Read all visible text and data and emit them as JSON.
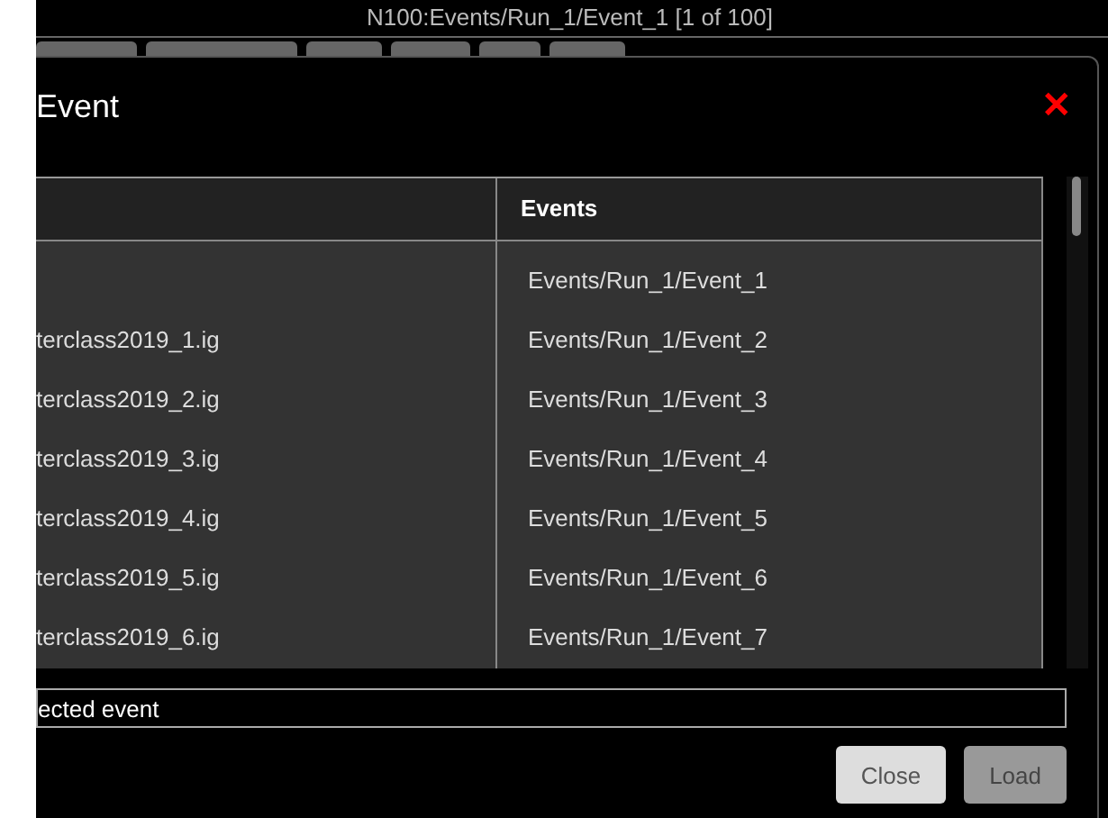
{
  "header": {
    "title": "N100:Events/Run_1/Event_1 [1 of 100]"
  },
  "dialog": {
    "title": "Event",
    "close": "✕",
    "table": {
      "columns": [
        "",
        "Events"
      ],
      "rows": [
        [
          "",
          "Events/Run_1/Event_1"
        ],
        [
          "terclass2019_1.ig",
          "Events/Run_1/Event_2"
        ],
        [
          "terclass2019_2.ig",
          "Events/Run_1/Event_3"
        ],
        [
          "terclass2019_3.ig",
          "Events/Run_1/Event_4"
        ],
        [
          "terclass2019_4.ig",
          "Events/Run_1/Event_5"
        ],
        [
          "terclass2019_5.ig",
          "Events/Run_1/Event_6"
        ],
        [
          "terclass2019_6.ig",
          "Events/Run_1/Event_7"
        ]
      ]
    },
    "field": {
      "value": "ected event"
    },
    "buttons": [
      {
        "label": "Close",
        "disabled": false
      },
      {
        "label": "Load",
        "disabled": true
      }
    ]
  }
}
